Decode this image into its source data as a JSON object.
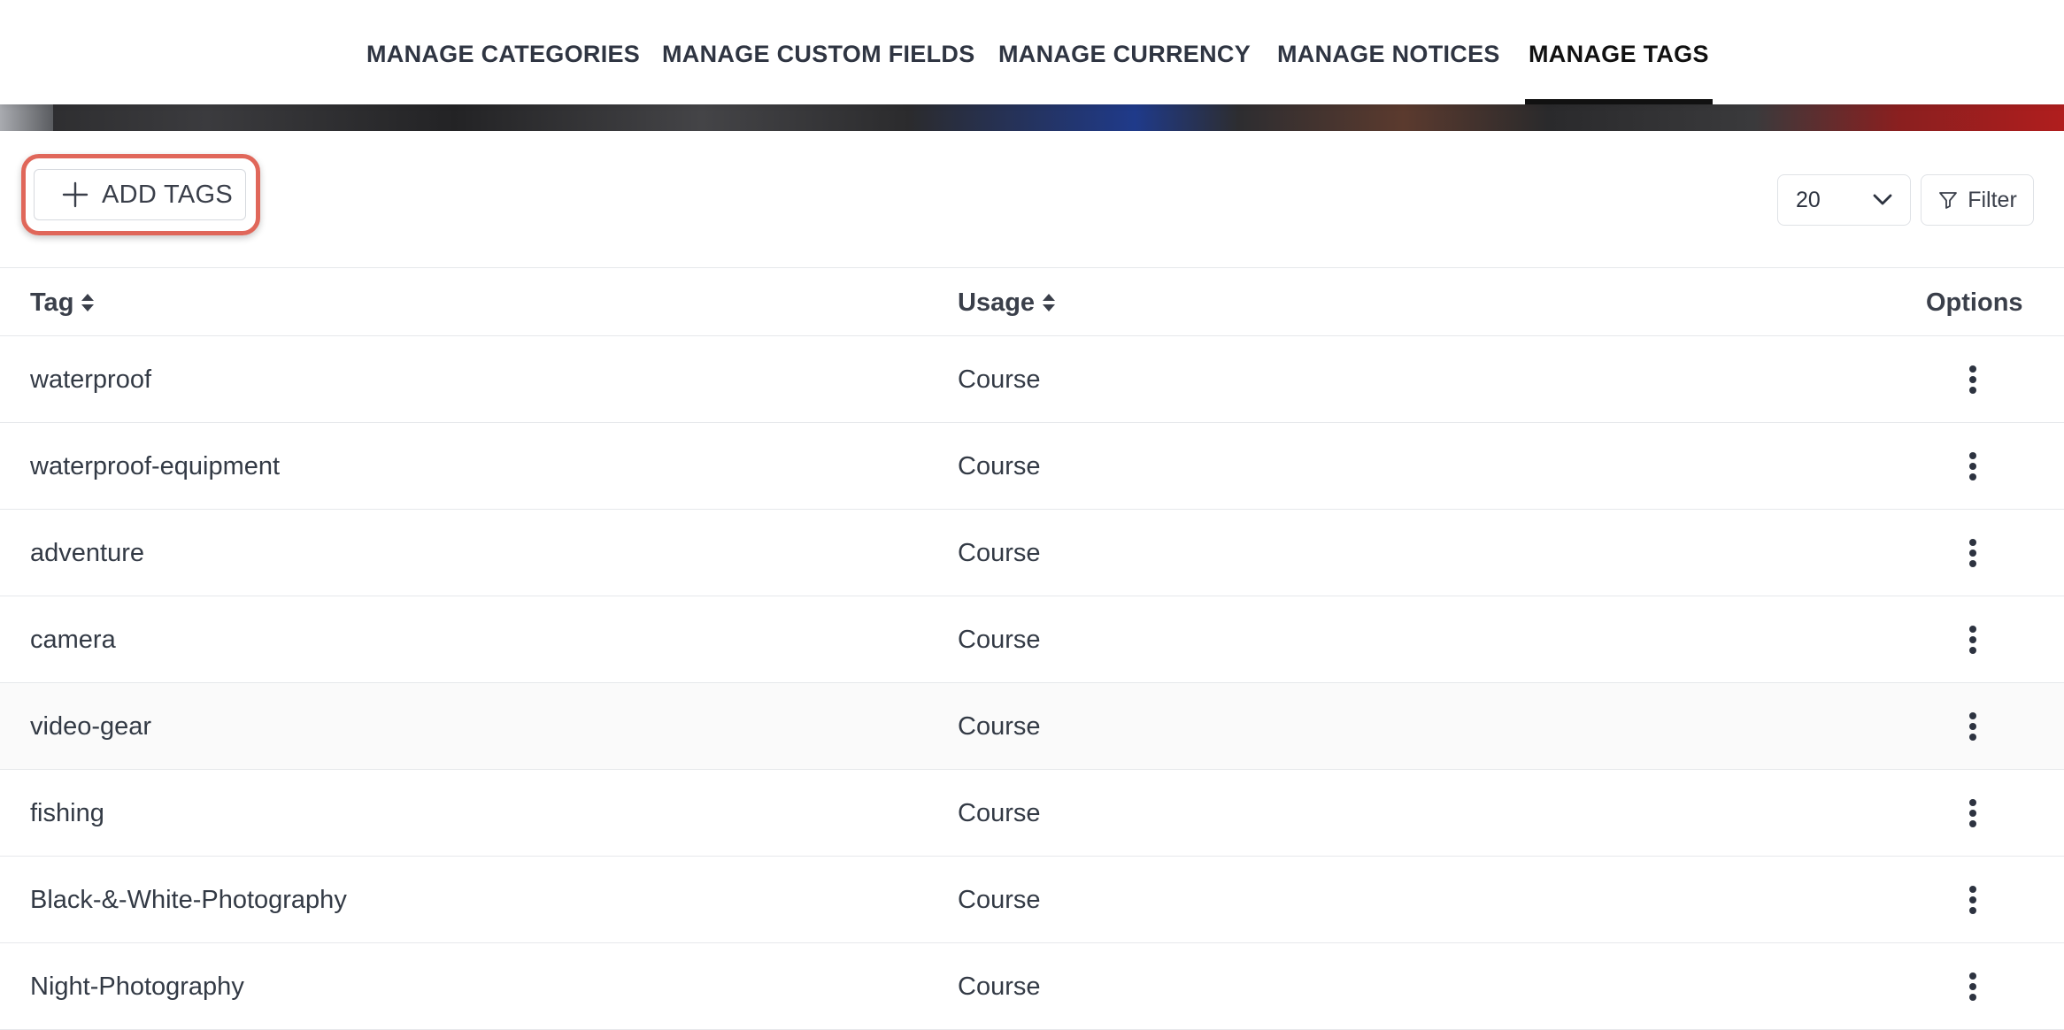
{
  "tabs": [
    {
      "label": "MANAGE CATEGORIES",
      "active": false
    },
    {
      "label": "MANAGE CUSTOM FIELDS",
      "active": false
    },
    {
      "label": "MANAGE CURRENCY",
      "active": false
    },
    {
      "label": "MANAGE NOTICES",
      "active": false
    },
    {
      "label": "MANAGE TAGS",
      "active": true
    }
  ],
  "toolbar": {
    "add_label": "ADD TAGS",
    "per_page": "20",
    "filter_label": "Filter"
  },
  "table": {
    "columns": [
      "Tag",
      "Usage",
      "Options"
    ],
    "rows": [
      {
        "tag": "waterproof",
        "usage": "Course"
      },
      {
        "tag": "waterproof-equipment",
        "usage": "Course"
      },
      {
        "tag": "adventure",
        "usage": "Course"
      },
      {
        "tag": "camera",
        "usage": "Course"
      },
      {
        "tag": "video-gear",
        "usage": "Course"
      },
      {
        "tag": "fishing",
        "usage": "Course"
      },
      {
        "tag": "Black-&-White-Photography",
        "usage": "Course"
      },
      {
        "tag": "Night-Photography",
        "usage": "Course"
      }
    ]
  },
  "icons": {
    "add": "plus-icon",
    "per_page": "chevron-down-icon",
    "filter": "filter-icon",
    "sort": "sort-icon",
    "options": "more-vertical-icon"
  },
  "colors": {
    "highlight_border": "#e0675a",
    "active_tab_underline": "#111111"
  }
}
